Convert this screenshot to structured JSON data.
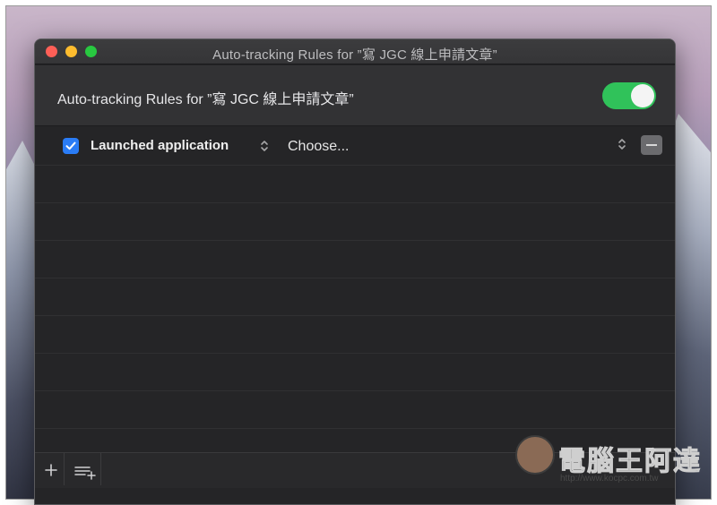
{
  "window": {
    "title": "Auto-tracking Rules for ”寫 JGC 線上申請文章”"
  },
  "header": {
    "label": "Auto-tracking Rules for ”寫 JGC 線上申請文章”",
    "toggle_on": true
  },
  "rules": [
    {
      "enabled": true,
      "type_label": "Launched application",
      "value_label": "Choose..."
    }
  ],
  "footer": {
    "add_icon": "plus-icon",
    "add_group_icon": "add-list-icon"
  },
  "watermark": {
    "text": "電腦王阿達",
    "url": "http://www.kocpc.com.tw"
  },
  "colors": {
    "toggle": "#30c25a",
    "checkbox": "#2a7cf6",
    "window_bg": "#252527"
  }
}
